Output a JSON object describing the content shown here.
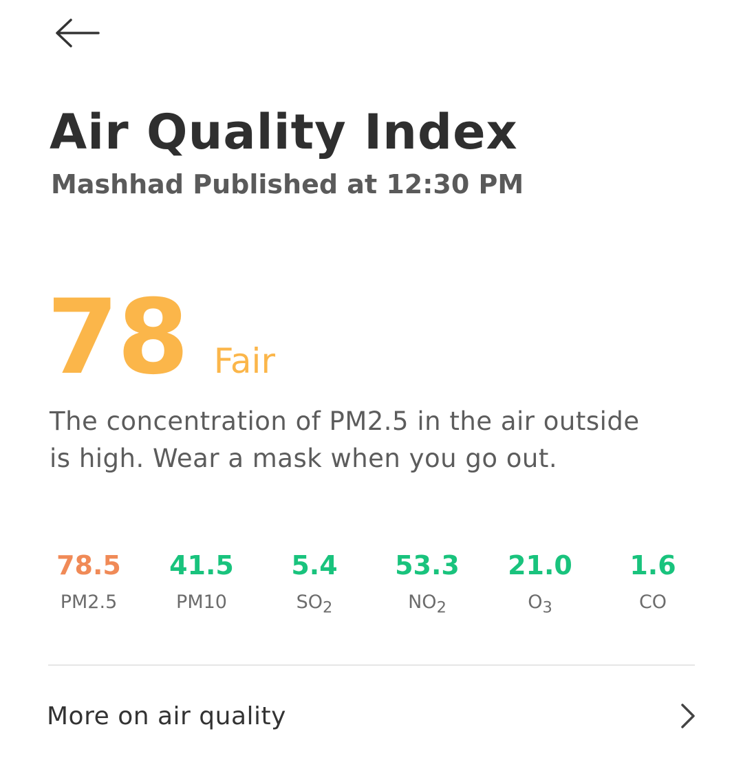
{
  "header": {
    "back_icon": "arrow-left-icon"
  },
  "title": "Air Quality Index",
  "subtitle": {
    "city": "Mashhad",
    "published": "Published at 12:30 PM"
  },
  "aqi": {
    "value": "78",
    "label": "Fair",
    "color": "#fbb64a"
  },
  "description": "The concentration of PM2.5 in the air outside is high. Wear a mask when you go out.",
  "pollutants": [
    {
      "value": "78.5",
      "name": "PM2.5",
      "sub": "",
      "color": "#f08a57"
    },
    {
      "value": "41.5",
      "name": "PM10",
      "sub": "",
      "color": "#19c37d"
    },
    {
      "value": "5.4",
      "name": "SO",
      "sub": "2",
      "color": "#19c37d"
    },
    {
      "value": "53.3",
      "name": "NO",
      "sub": "2",
      "color": "#19c37d"
    },
    {
      "value": "21.0",
      "name": "O",
      "sub": "3",
      "color": "#19c37d"
    },
    {
      "value": "1.6",
      "name": "CO",
      "sub": "",
      "color": "#19c37d"
    }
  ],
  "more": {
    "label": "More on air quality",
    "icon": "chevron-right-icon"
  }
}
